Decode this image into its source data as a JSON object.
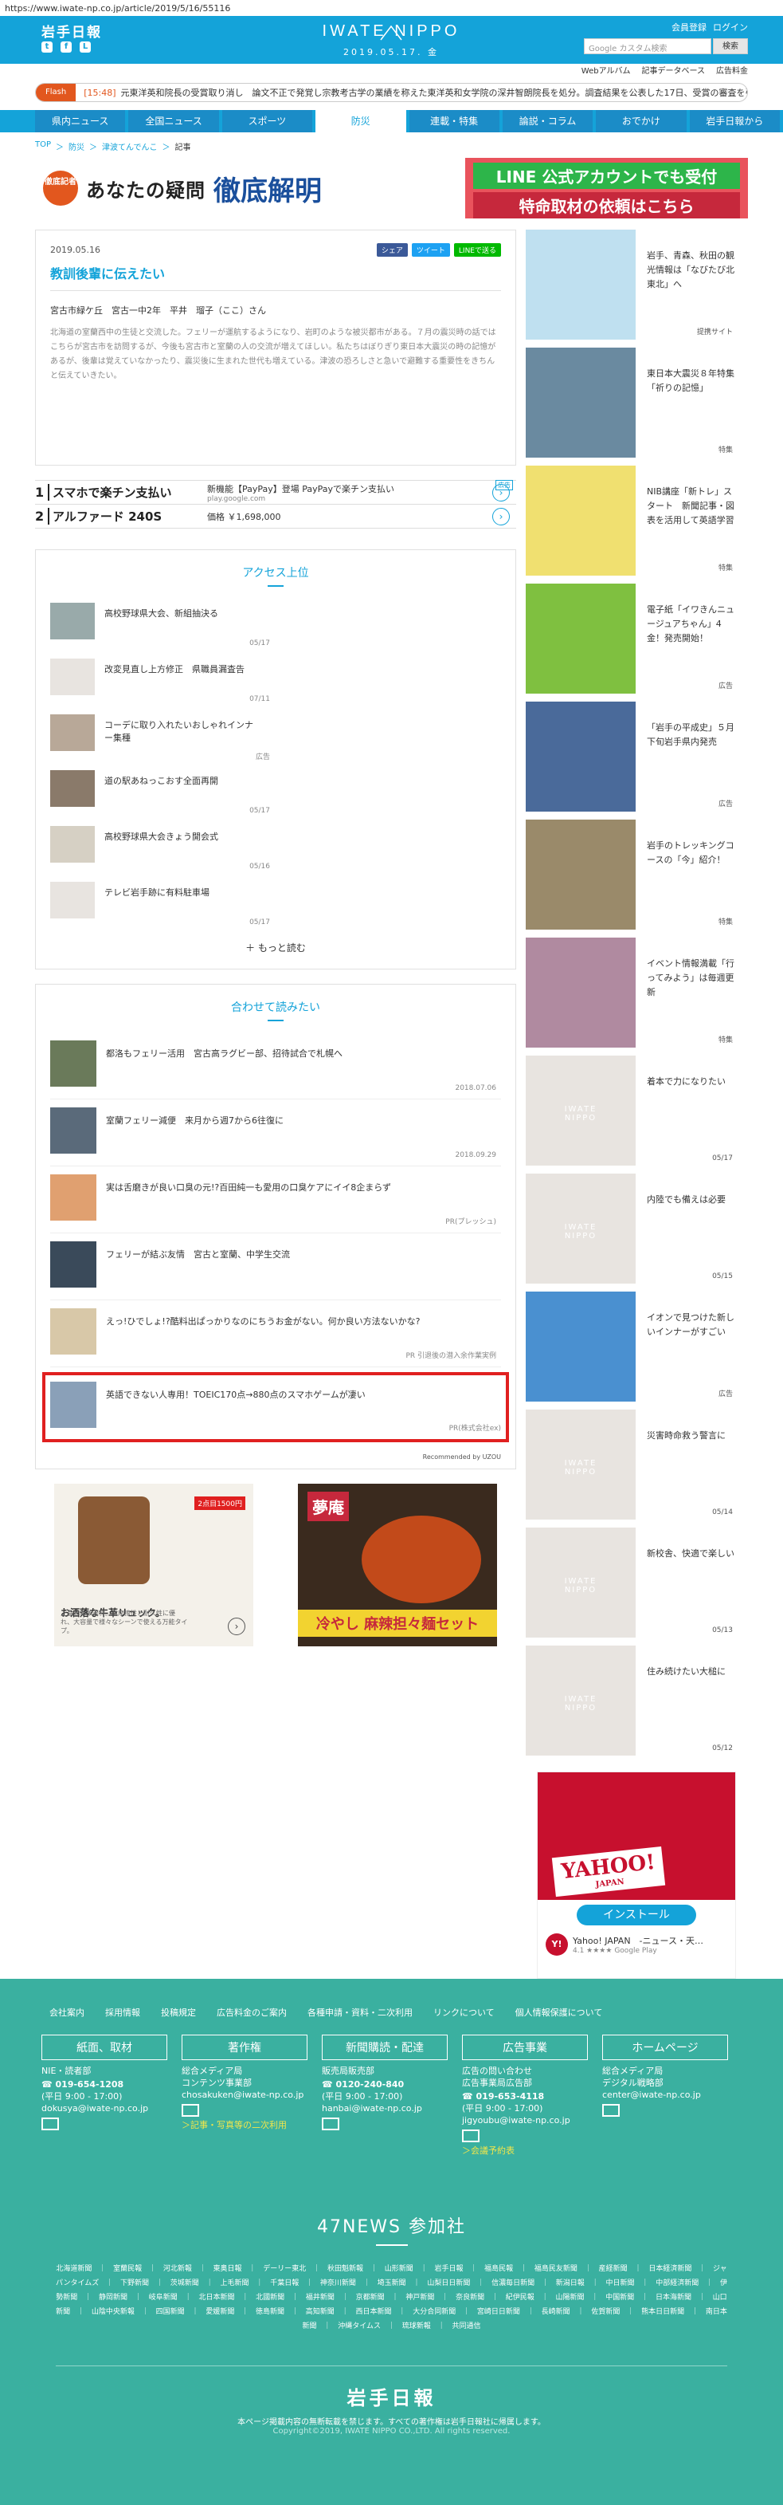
{
  "url": "https://www.iwate-np.co.jp/article/2019/5/16/55116",
  "header": {
    "logo_jp": "岩手日報",
    "brand": "IWATE NIPPO",
    "date": "2019.05.17. 金",
    "member_links": [
      "会員登録",
      "ログイン"
    ],
    "search_placeholder": "Google カスタム検索",
    "search_button": "検索",
    "subnav": [
      "Webアルバム",
      "記事データベース",
      "広告料金"
    ]
  },
  "flash": {
    "tag": "Flash",
    "time": "[15:48]",
    "text": "元東洋英和院長の受賞取り消し　論文不正で発覚し宗教考古学の業績を称えた東洋英和女学院の深井智朗院長を処分。調査結果を公表した17日、受賞の審査を引き…"
  },
  "gnav": [
    "県内ニュース",
    "全国ニュース",
    "スポーツ",
    "防災",
    "連載・特集",
    "論説・コラム",
    "おでかけ",
    "岩手日報から"
  ],
  "breadcrumb": [
    "TOP",
    "防災",
    "津波てんでんこ",
    "記事"
  ],
  "top_banner": {
    "badge": "徹底記者",
    "title": "あなたの疑問",
    "title2": "徹底解明",
    "line1": "LINE 公式アカウントでも受付",
    "line2": "特命取材の依頼はこちら"
  },
  "article": {
    "date": "2019.05.16",
    "share": [
      "シェア",
      "ツイート",
      "LINEで送る"
    ],
    "title": "教訓後輩に伝えたい",
    "author": "宮古市緑ケ丘　宮古一中2年　平井　瑠子（ここ）さん",
    "body": "北海道の室蘭西中の生徒と交流した。フェリーが運航するようになり、岩町のような被災都市がある。７月の震災時の話ではこちらが宮古市を訪問するが、今後も宮古市と室蘭の人の交流が増えてほしい。私たちはぼりぎり東日本大震災の時の記憶があるが、後輩は覚えていなかったり、震災後に生まれた世代も増えている。津波の恐ろしさと急いで避難する重要性をきちんと伝えていきたい。"
  },
  "ads": [
    {
      "num": "1",
      "kw": "スマホで楽チン支払い",
      "desc": "新機能【PayPay】登場 PayPayで楽チン支払い",
      "sub": "play.google.com"
    },
    {
      "num": "2",
      "kw": "アルファード 240S",
      "desc": "価格 ￥1,698,000",
      "sub": ""
    }
  ],
  "ad_tag": "広告",
  "ranking": {
    "title": "アクセス上位",
    "items": [
      {
        "text": "高校野球県大会、新組抽決る",
        "date": "05/17"
      },
      {
        "text": "改変見直し上方修正　県職員漏査告",
        "date": "07/11"
      },
      {
        "text": "コーデに取り入れたいおしゃれインナー集種",
        "date": "広告"
      },
      {
        "text": "道の駅あねっこおす全面再開",
        "date": "05/17"
      },
      {
        "text": "高校野球県大会きょう開会式",
        "date": "05/16"
      },
      {
        "text": "テレビ岩手跡に有料駐車場",
        "date": "05/17"
      }
    ],
    "more": "もっと読む"
  },
  "recommend": {
    "title": "合わせて読みたい",
    "items": [
      {
        "text": "都洛もフェリー活用　宮古高ラグビー部、招待試合で札幌へ",
        "date": "2018.07.06"
      },
      {
        "text": "室蘭フェリー減便　来月から週7から6往復に",
        "date": "2018.09.29"
      },
      {
        "text": "実は舌磨きが良い口臭の元!?百田純一も愛用の口臭ケアにイイ8企まらず",
        "date": "PR(プレッシュ)"
      },
      {
        "text": "フェリーが結ぶ友情　宮古と室蘭、中学生交流",
        "date": ""
      },
      {
        "text": "えっ!ひでしょ!?酷料出ぱっかりなのにちうお金がない。何か良い方法ないかな?",
        "date": "PR 引退後の潜入余作業実例"
      },
      {
        "text": "英語できない人専用！TOEIC170点→880点のスマホゲームが凄い",
        "date": "PR(株式会社ex)"
      }
    ],
    "powered": "Recommended by UZOU"
  },
  "bottom_ads": {
    "ad1_title": "お洒落な牛革リュック。",
    "ad1_sub": "上品な本革素材。耐摩擦性と耐久性に優れ、大容量で様々なシーンで使える万能タイプ。",
    "ad1_price": "2点目1500円",
    "ad2_logo": "夢庵",
    "ad2_text": "冷やし 麻辣担々麺セット"
  },
  "sidebar": [
    {
      "text": "岩手、青森、秋田の観光情報は「なびたび北東北」へ",
      "tag": "提携サイト"
    },
    {
      "text": "東日本大震災８年特集「祈りの記憶」",
      "tag": "特集"
    },
    {
      "text": "NIB講座「新トレ」スタート　新聞記事・図表を活用して英語学習",
      "tag": "特集"
    },
    {
      "text": "電子紙「イワきんニュージュアちゃん」4金！発売開始！",
      "tag": "広告"
    },
    {
      "text": "「岩手の平成史」５月下旬岩手県内発売",
      "tag": "広告"
    },
    {
      "text": "岩手のトレッキングコースの「今」紹介！",
      "tag": "特集"
    },
    {
      "text": "イベント情報満載「行ってみよう」は毎週更新",
      "tag": "特集"
    },
    {
      "text": "着本で力になりたい",
      "tag": "05/17"
    },
    {
      "text": "内陸でも備えは必要",
      "tag": "05/15"
    },
    {
      "text": "イオンで見つけた新しいインナーがすごい",
      "tag": "広告"
    },
    {
      "text": "災害時命救う警言に",
      "tag": "05/14"
    },
    {
      "text": "新校舎、快適で楽しい",
      "tag": "05/13"
    },
    {
      "text": "住み続けたい大槌に",
      "tag": "05/12"
    }
  ],
  "yahoo_ad": {
    "logo": "YAHOO!",
    "sub": "JAPAN",
    "button": "インストール",
    "app_name": "Yahoo! JAPAN　-ニュース・天…",
    "rating": "4.1 ★★★★",
    "store": "Google Play"
  },
  "footer": {
    "links": [
      "会社案内",
      "採用情報",
      "投稿規定",
      "広告料金のご案内",
      "各種申請・資料・二次利用",
      "リンクについて",
      "個人情報保護について"
    ],
    "cols": [
      {
        "title": "紙面、取材",
        "lines": [
          "NIE・読者部"
        ],
        "tel": "019-654-1208",
        "hours": "(平日 9:00 - 17:00)",
        "mail": "dokusya@iwate-np.co.jp",
        "extra": ""
      },
      {
        "title": "著作権",
        "lines": [
          "総合メディア局",
          "コンテンツ事業部"
        ],
        "tel": "",
        "hours": "",
        "mail": "chosakuken@iwate-np.co.jp",
        "extra": "＞記事・写真等の二次利用"
      },
      {
        "title": "新聞購読・配達",
        "lines": [
          "販売局販売部"
        ],
        "tel": "0120-240-840",
        "hours": "(平日 9:00 - 17:00)",
        "mail": "hanbai@iwate-np.co.jp",
        "extra": ""
      },
      {
        "title": "広告事業",
        "lines": [
          "広告の問い合わせ",
          "広告事業局広告部"
        ],
        "tel": "019-653-4118",
        "hours": "(平日 9:00 - 17:00)",
        "mail": "jigyoubu@iwate-np.co.jp",
        "extra": "＞会議予約表"
      },
      {
        "title": "ホームページ",
        "lines": [
          "総合メディア局",
          "デジタル戦略部"
        ],
        "tel": "",
        "hours": "",
        "mail": "center@iwate-np.co.jp",
        "extra": ""
      }
    ],
    "news47_title": "47NEWS 参加社",
    "papers": "北海道新聞 ｜ 室蘭民報 ｜ 河北新報 ｜ 東奥日報 ｜ デーリー東北 ｜ 秋田魁新報 ｜ 山形新聞 ｜ 岩手日報 ｜ 福島民報 ｜ 福島民友新聞 ｜ 産経新聞 ｜ 日本経済新聞 ｜ ジャパンタイムズ ｜ 下野新聞 ｜ 茨城新聞 ｜ 上毛新聞 ｜ 千葉日報 ｜ 神奈川新聞 ｜ 埼玉新聞 ｜ 山梨日日新聞 ｜ 信濃毎日新聞 ｜ 新潟日報 ｜ 中日新聞 ｜ 中部経済新聞 ｜ 伊勢新聞 ｜ 静岡新聞 ｜ 岐阜新聞 ｜ 北日本新聞 ｜ 北國新聞 ｜ 福井新聞 ｜ 京都新聞 ｜ 神戸新聞 ｜ 奈良新聞 ｜ 紀伊民報 ｜ 山陽新聞 ｜ 中国新聞 ｜ 日本海新聞 ｜ 山口新聞 ｜ 山陰中央新報 ｜ 四国新聞 ｜ 愛媛新聞 ｜ 徳島新聞 ｜ 高知新聞 ｜ 西日本新聞 ｜ 大分合同新聞 ｜ 宮崎日日新聞 ｜ 長崎新聞 ｜ 佐賀新聞 ｜ 熊本日日新聞 ｜ 南日本新聞 ｜ 沖縄タイムス ｜ 琉球新報 ｜ 共同通信",
    "logo": "岩手日報",
    "notice": "本ページ掲載内容の無断転載を禁じます。すべての著作権は岩手日報社に帰属します。",
    "copyright": "Copyright©2019, IWATE NIPPO CO.,LTD. All rights reserved."
  },
  "colors": {
    "accent": "#14a3d9",
    "footer": "#3ab0a0",
    "flash": "#e2571e",
    "highlight": "#e02020"
  }
}
